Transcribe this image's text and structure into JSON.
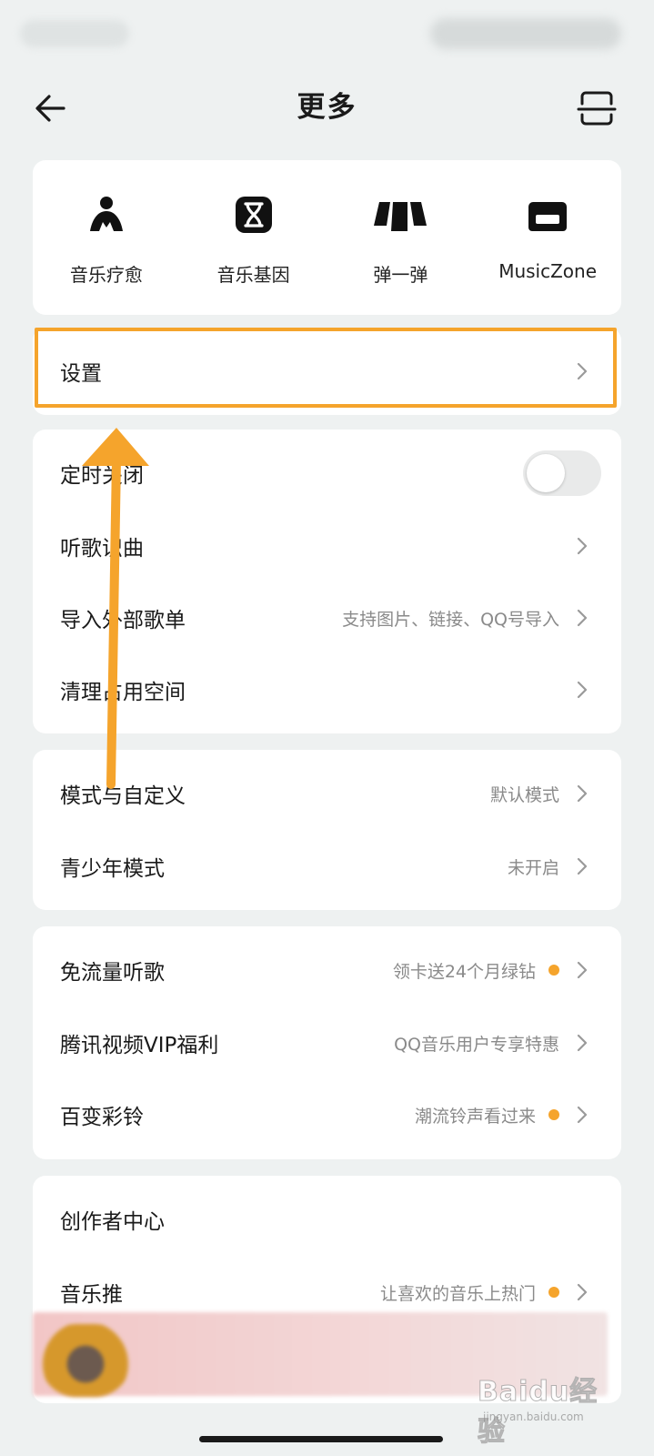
{
  "header": {
    "title": "更多",
    "back_icon": "back-arrow-icon",
    "scan_icon": "scan-icon"
  },
  "features": [
    {
      "label": "音乐疗愈",
      "icon": "music-healing-icon"
    },
    {
      "label": "音乐基因",
      "icon": "music-gene-icon"
    },
    {
      "label": "弹一弹",
      "icon": "piano-keys-icon"
    },
    {
      "label": "MusicZone",
      "icon": "sofa-icon"
    }
  ],
  "settings": {
    "label": "设置"
  },
  "group1": {
    "timer_off": {
      "label": "定时关闭",
      "toggle_on": false
    },
    "song_recognition": {
      "label": "听歌识曲"
    },
    "import_playlist": {
      "label": "导入外部歌单",
      "value": "支持图片、链接、QQ号导入"
    },
    "clean_space": {
      "label": "清理占用空间"
    }
  },
  "group2": {
    "mode": {
      "label": "模式与自定义",
      "value": "默认模式"
    },
    "youth": {
      "label": "青少年模式",
      "value": "未开启"
    }
  },
  "group3": {
    "free_data": {
      "label": "免流量听歌",
      "value": "领卡送24个月绿钻"
    },
    "tencent_video": {
      "label": "腾讯视频VIP福利",
      "value": "QQ音乐用户专享特惠"
    },
    "ringtone": {
      "label": "百变彩铃",
      "value": "潮流铃声看过来"
    }
  },
  "group4": {
    "creator": {
      "label": "创作者中心"
    },
    "music_push": {
      "label": "音乐推",
      "value": "让喜欢的音乐上热门"
    }
  },
  "colors": {
    "accent": "#f5a42c",
    "background": "#eef1f1",
    "card": "#ffffff"
  },
  "watermark": {
    "main": "Baidu经验",
    "sub": "jingyan.baidu.com"
  }
}
